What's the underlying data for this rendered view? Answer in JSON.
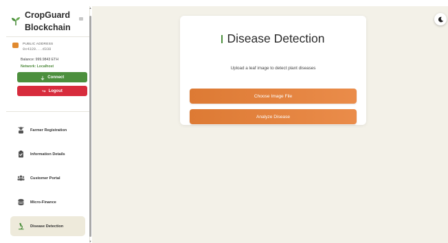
{
  "brand": {
    "name_line1": "CropGuard",
    "name_line2": "Blockchain"
  },
  "wallet": {
    "label": "PUBLIC ADDRESS",
    "address": "0x4320...d338",
    "balance": "Balance: 999.9843 ETH",
    "network": "Network: Localhost"
  },
  "actions": {
    "connect_label": "Connect",
    "logout_label": "Logout"
  },
  "nav": {
    "items": [
      {
        "label": "Farmer Registration",
        "icon": "farmer-icon"
      },
      {
        "label": "Information Details",
        "icon": "clipboard-icon"
      },
      {
        "label": "Customer Portal",
        "icon": "users-icon"
      },
      {
        "label": "Micro-Finance",
        "icon": "coins-icon"
      },
      {
        "label": "Disease Detection",
        "icon": "microscope-icon",
        "active": true
      }
    ]
  },
  "main": {
    "title": "Disease Detection",
    "subtitle": "Upload a leaf image to detect plant diseases",
    "choose_label": "Choose Image File",
    "analyze_label": "Analyze Disease"
  },
  "colors": {
    "accent_green": "#4c8f3d",
    "logout_red": "#d72c3d",
    "button_orange": "#e0843d",
    "background": "#f3f1e8"
  }
}
